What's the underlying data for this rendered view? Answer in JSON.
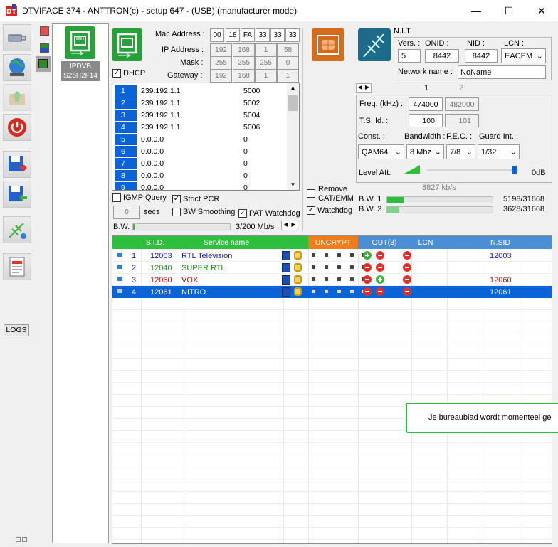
{
  "window": {
    "title": "DTVIFACE 374 - ANTTRON(c) - setup 647 - (USB) (manufacturer mode)",
    "minimize": "—",
    "maximize": "☐",
    "close": "✕"
  },
  "sidebar": {
    "logs_label": "LOGS"
  },
  "device": {
    "name_line1": "IPDVB",
    "name_line2": "S26H2F14"
  },
  "network": {
    "mac_label": "Mac Address :",
    "mac": [
      "00",
      "18",
      "FA",
      "33",
      "33",
      "33"
    ],
    "ip_label": "IP Address :",
    "ip": [
      "192",
      "168",
      "1",
      "58"
    ],
    "mask_label": "Mask :",
    "mask": [
      "255",
      "255",
      "255",
      "0"
    ],
    "gw_label": "Gateway :",
    "gw": [
      "192",
      "168",
      "1",
      "1"
    ],
    "dhcp_label": "DHCP"
  },
  "ip_rows": [
    {
      "n": "1",
      "ip": "239.192.1.1",
      "port": "5000"
    },
    {
      "n": "2",
      "ip": "239.192.1.1",
      "port": "5002"
    },
    {
      "n": "3",
      "ip": "239.192.1.1",
      "port": "5004"
    },
    {
      "n": "4",
      "ip": "239.192.1.1",
      "port": "5006"
    },
    {
      "n": "5",
      "ip": "0.0.0.0",
      "port": "0"
    },
    {
      "n": "6",
      "ip": "0.0.0.0",
      "port": "0"
    },
    {
      "n": "7",
      "ip": "0.0.0.0",
      "port": "0"
    },
    {
      "n": "8",
      "ip": "0.0.0.0",
      "port": "0"
    },
    {
      "n": "9",
      "ip": "0.0.0.0",
      "port": "0"
    }
  ],
  "options": {
    "igmp_label": "IGMP Query",
    "strict_label": "Strict PCR",
    "secs_value": "0",
    "secs_label": "secs",
    "bw_smooth_label": "BW Smoothing",
    "pat_label": "PAT Watchdog",
    "bw_label": "B.W.",
    "bw_value": "3/200 Mb/s",
    "bw_fraction": 0.015
  },
  "cam": {
    "remove_label": "Remove",
    "catemm_label": "CAT/EMM",
    "watchdog_label": "Watchdog"
  },
  "nit": {
    "title": "N.I.T.",
    "vers_label": "Vers. :",
    "vers": "5",
    "onid_label": "ONID :",
    "onid": "8442",
    "nid_label": "NID :",
    "nid": "8442",
    "lcn_label": "LCN :",
    "lcn": "EACEM",
    "netname_label": "Network name :",
    "netname": "NoName"
  },
  "tuner": {
    "tab1": "1",
    "tab2": "2",
    "freq_label": "Freq. (kHz) :",
    "freq": "474000",
    "freq2": "482000",
    "tsid_label": "T.S. Id. :",
    "tsid": "100",
    "tsid2": "101",
    "const_label": "Const. :",
    "const": "QAM64",
    "bandwidth_label": "Bandwidth :",
    "bandwidth": "8 Mhz",
    "fec_label": "F.E.C. :",
    "fec": "7/8",
    "guard_label": "Guard Int. :",
    "guard": "1/32",
    "level_label": "Level Att.",
    "level_db": "0dB",
    "rate": "8827 kb/s",
    "bw1_label": "B.W. 1",
    "bw1": "5198/31668",
    "bw1_fraction": 0.164,
    "bw2_label": "B.W. 2",
    "bw2": "3628/31668",
    "bw2_fraction": 0.115
  },
  "services": {
    "headers": {
      "sid": "S.I.D.",
      "name": "Service name",
      "uncrypt": "UNCRYPT",
      "out": "OUT(3)",
      "lcn": "LCN",
      "nsid": "N.SID"
    },
    "rows": [
      {
        "n": "1",
        "sid": "12003",
        "name": "RTL Television",
        "nsid": "12003",
        "color": "#1a1aa0",
        "out1": "green",
        "out2": "red"
      },
      {
        "n": "2",
        "sid": "12040",
        "name": "SUPER RTL",
        "nsid": "",
        "color": "#1a8a1a",
        "out1": "red",
        "out2": "red"
      },
      {
        "n": "3",
        "sid": "12060",
        "name": "VOX",
        "nsid": "12060",
        "color": "#b01010",
        "out1": "red",
        "out2": "green"
      },
      {
        "n": "4",
        "sid": "12061",
        "name": "NITRO",
        "nsid": "12061",
        "color": "#ffffff",
        "out1": "red",
        "out2": "red"
      }
    ]
  },
  "notification": {
    "text": "Je bureaublad wordt momenteel ge"
  },
  "colors": {
    "accent_green": "#2dbf3c",
    "header_blue": "#4a8fd6",
    "uncrypt_orange": "#f07c1a",
    "selection": "#0b63d8"
  }
}
